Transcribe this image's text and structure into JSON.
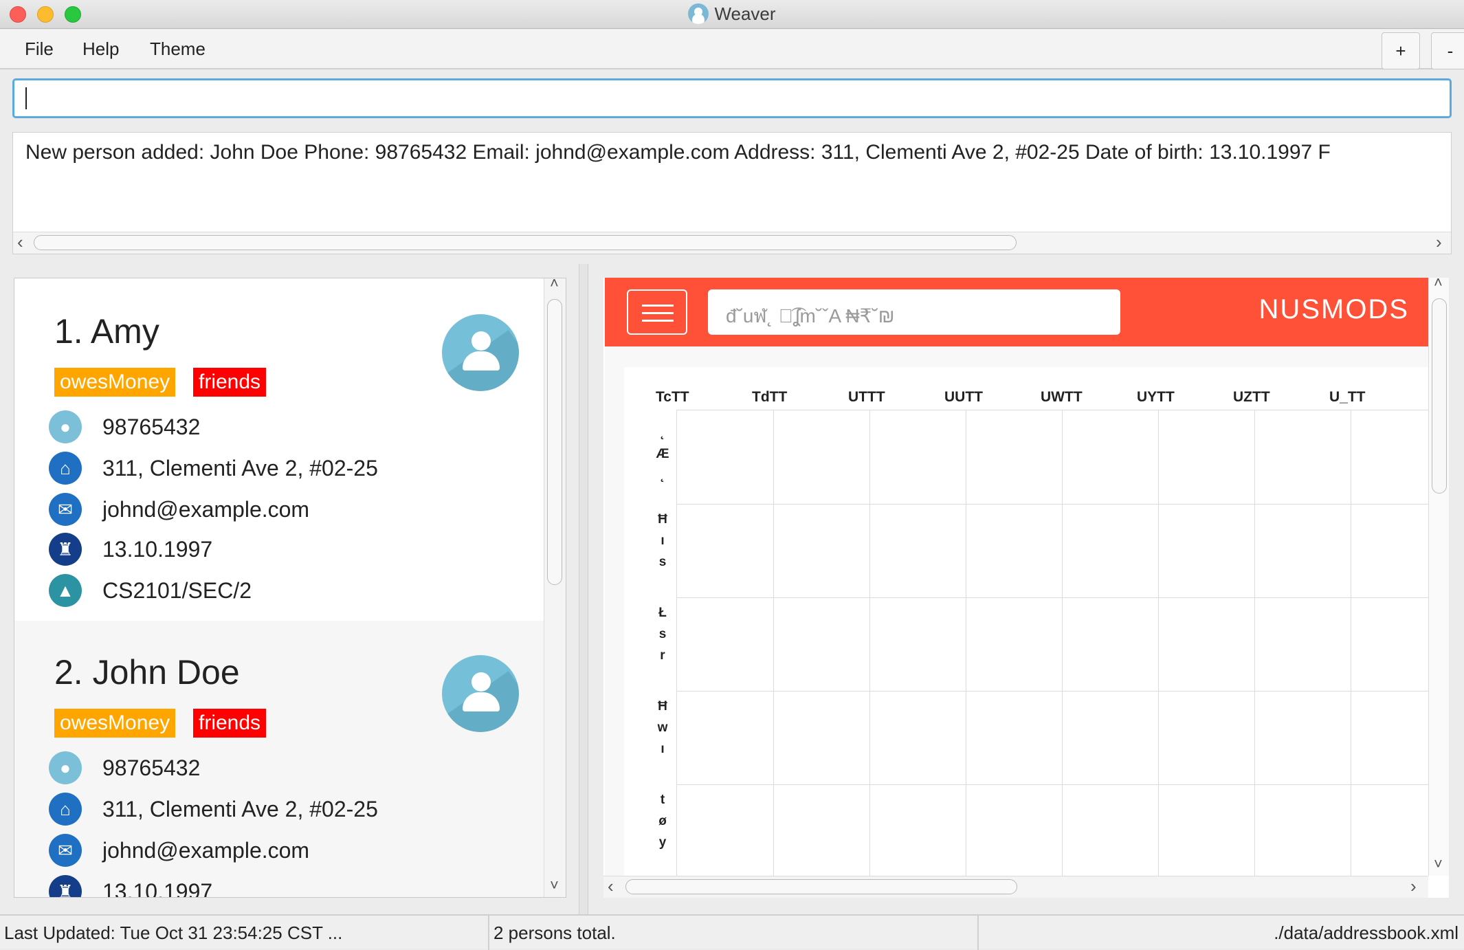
{
  "window": {
    "title": "Weaver"
  },
  "menu": {
    "items": [
      "File",
      "Help",
      "Theme"
    ],
    "zoom_in": "+",
    "zoom_out": "-"
  },
  "command_box": {
    "value": ""
  },
  "result_display": {
    "text": "New person added: John Doe Phone: 98765432 Email: johnd@example.com Address: 311, Clementi Ave 2, #02-25 Date of birth: 13.10.1997 F"
  },
  "persons": [
    {
      "index_name": "1. Amy",
      "tags": [
        "owesMoney",
        "friends"
      ],
      "phone": "98765432",
      "address": "311, Clementi Ave 2, #02-25",
      "email": "johnd@example.com",
      "birthday": "13.10.1997",
      "timetable": "CS2101/SEC/2"
    },
    {
      "index_name": "2. John Doe",
      "tags": [
        "owesMoney",
        "friends"
      ],
      "phone": "98765432",
      "address": "311, Clementi Ave 2, #02-25",
      "email": "johnd@example.com",
      "birthday": "13.10.1997"
    }
  ],
  "nusmods": {
    "search_placeholder": "đ˘uฬ˛ ฬ͡ʆm˘ˇA ₦₹˘₪",
    "logo": "NUSMODS",
    "days": [
      "TcTT",
      "TdTT",
      "UTTT",
      "UUTT",
      "UWTT",
      "UYTT",
      "UZTT",
      "U_TT"
    ],
    "row_labels": [
      "˛\nÆ\n˛",
      "Ħ\nı\ns",
      "Ł\ns\nr",
      "Ħ\nw\nı",
      "t\nø\ny"
    ]
  },
  "status": {
    "last_updated": "Last Updated: Tue Oct 31 23:54:25 CST ...",
    "total": "2 persons total.",
    "path": "./data/addressbook.xml"
  },
  "colors": {
    "nusmods_red": "#ff5138",
    "tag_orange": "#ffa500",
    "tag_red": "#ff0000",
    "focus_blue": "#5aaadd"
  }
}
